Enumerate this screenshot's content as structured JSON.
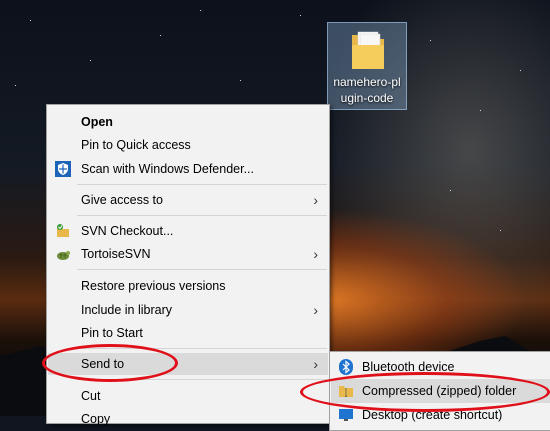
{
  "desktop": {
    "folder_label": "namehero-plugin-code"
  },
  "context_menu": {
    "items": [
      {
        "label": "Open",
        "bold": true
      },
      {
        "label": "Pin to Quick access"
      },
      {
        "label": "Scan with Windows Defender...",
        "icon": "windows-defender-icon"
      },
      {
        "label": "Give access to",
        "submenu": true
      },
      {
        "label": "SVN Checkout...",
        "icon": "svn-checkout-icon"
      },
      {
        "label": "TortoiseSVN",
        "icon": "tortoisesvn-icon",
        "submenu": true
      },
      {
        "label": "Restore previous versions"
      },
      {
        "label": "Include in library",
        "submenu": true
      },
      {
        "label": "Pin to Start"
      },
      {
        "label": "Send to",
        "submenu": true,
        "highlighted": true
      },
      {
        "label": "Cut"
      },
      {
        "label": "Copy"
      }
    ]
  },
  "send_to_submenu": {
    "items": [
      {
        "label": "Bluetooth device",
        "icon": "bluetooth-icon"
      },
      {
        "label": "Compressed (zipped) folder",
        "icon": "zip-folder-icon",
        "highlighted": true
      },
      {
        "label": "Desktop (create shortcut)",
        "icon": "desktop-icon"
      }
    ]
  },
  "colors": {
    "menu_bg": "#f2f2f2",
    "highlight": "#dadada",
    "annotation_ring": "#e0101a"
  }
}
